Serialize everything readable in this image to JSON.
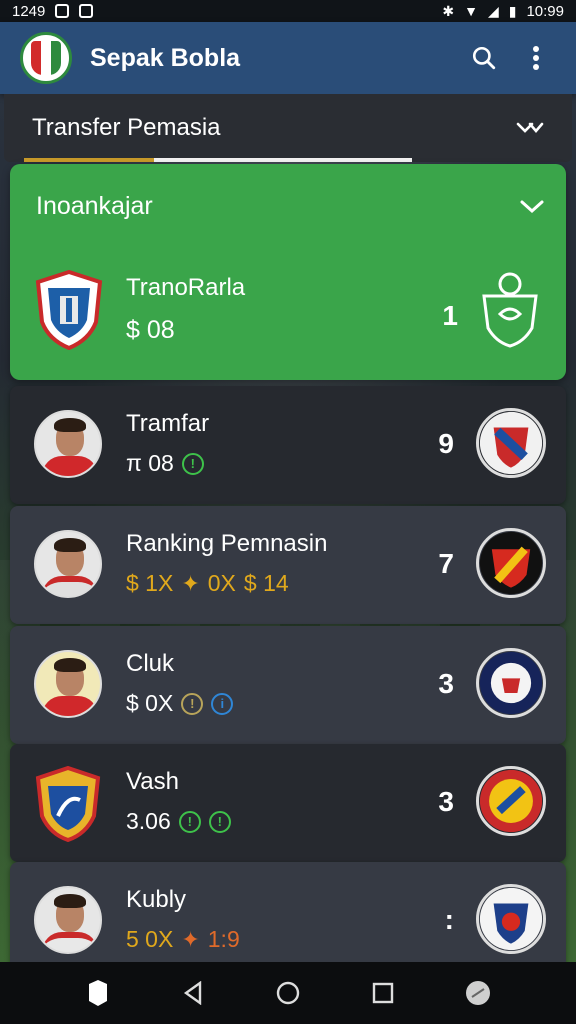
{
  "status_bar": {
    "time_left": "1249",
    "time_right": "10:99"
  },
  "app_bar": {
    "title": "Sepak Bobla"
  },
  "section": {
    "title": "Transfer Pemasia"
  },
  "highlight": {
    "heading": "Inoankajar",
    "name": "TranoRarla",
    "value": "$ 08",
    "rank": "1"
  },
  "rows": [
    {
      "name": "Tramfar",
      "stats": [
        "π 08"
      ],
      "rank": "9"
    },
    {
      "name": "Ranking Pemnasin",
      "stats": [
        "$ 1X",
        "0X",
        "$ 14"
      ],
      "rank": "7"
    },
    {
      "name": "Cluk",
      "stats": [
        "$ 0X"
      ],
      "rank": "3"
    },
    {
      "name": "Vash",
      "stats": [
        "3.06"
      ],
      "rank": "3"
    },
    {
      "name": "Kubly",
      "stats": [
        "5 0X",
        "1:9"
      ],
      "rank": ":"
    }
  ],
  "colors": {
    "app_bar": "#2a4d78",
    "highlight": "#3aa54a",
    "gold": "#e0a81c",
    "green_icon": "#3ec24a",
    "blue_icon": "#2f86d6",
    "orange": "#e06a2a"
  },
  "icons": {
    "search": "search-icon",
    "more": "more-vert-icon",
    "chevron": "chevron-down-icon"
  }
}
